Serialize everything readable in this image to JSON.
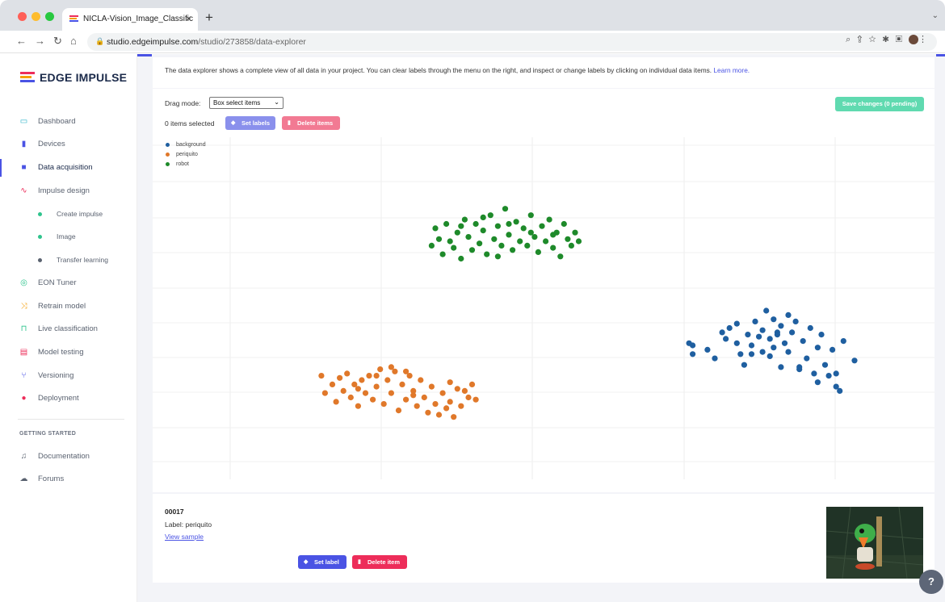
{
  "browser": {
    "tab_title": "NICLA-Vision_Image_Classific",
    "tab_close": "×",
    "new_tab": "+",
    "address_host": "studio.edgeimpulse.com",
    "address_path": "/studio/273858/data-explorer",
    "icons": [
      "back-icon",
      "forward-icon",
      "reload-icon",
      "home-icon",
      "lock-icon",
      "zoom-icon",
      "share-icon",
      "star-icon",
      "extensions-icon",
      "sidebar-icon",
      "profile-icon",
      "menu-icon"
    ]
  },
  "sidebar": {
    "logo_text": "EDGE IMPULSE",
    "items": [
      {
        "label": "Dashboard",
        "icon": "monitor-icon",
        "color": "#2bb3c9"
      },
      {
        "label": "Devices",
        "icon": "device-icon",
        "color": "#4a53e4"
      },
      {
        "label": "Data acquisition",
        "icon": "database-icon",
        "color": "#4a53e4"
      },
      {
        "label": "Impulse design",
        "icon": "pulse-icon",
        "color": "#ed2d5a"
      },
      {
        "label": "Create impulse",
        "color": "#2fc48d"
      },
      {
        "label": "Image",
        "color": "#2fc48d"
      },
      {
        "label": "Transfer learning",
        "color": "#5a6270"
      },
      {
        "label": "EON Tuner",
        "icon": "tuner-icon",
        "color": "#2fc48d"
      },
      {
        "label": "Retrain model",
        "icon": "shuffle-icon",
        "color": "#f59e0b"
      },
      {
        "label": "Live classification",
        "icon": "live-icon",
        "color": "#2fc48d"
      },
      {
        "label": "Model testing",
        "icon": "clipboard-icon",
        "color": "#ed2d5a"
      },
      {
        "label": "Versioning",
        "icon": "branch-icon",
        "color": "#4a53e4"
      },
      {
        "label": "Deployment",
        "icon": "rocket-icon",
        "color": "#ed2d5a"
      }
    ],
    "section_heading": "GETTING STARTED",
    "footer_items": [
      {
        "label": "Documentation",
        "icon": "book-icon"
      },
      {
        "label": "Forums",
        "icon": "chat-icon"
      }
    ]
  },
  "info": {
    "text": "The data explorer shows a complete view of all data in your project. You can clear labels through the menu on the right, and inspect or change labels by clicking on individual data items.",
    "link": "Learn more."
  },
  "controls": {
    "drag_mode_label": "Drag mode:",
    "drag_mode_value": "Box select items",
    "save_changes": "Save changes (0 pending)",
    "items_selected": "0 items selected",
    "set_labels": "Set labels",
    "delete_items": "Delete items"
  },
  "chart_data": {
    "type": "scatter",
    "grid": true,
    "legend_placement": "top-left",
    "series": [
      {
        "name": "background",
        "color": "#1f5fa0",
        "points": [
          [
            0.65,
            -0.35
          ],
          [
            0.66,
            -0.36
          ],
          [
            0.66,
            -0.4
          ],
          [
            0.7,
            -0.38
          ],
          [
            0.72,
            -0.42
          ],
          [
            0.74,
            -0.3
          ],
          [
            0.75,
            -0.33
          ],
          [
            0.76,
            -0.28
          ],
          [
            0.78,
            -0.35
          ],
          [
            0.79,
            -0.4
          ],
          [
            0.8,
            -0.45
          ],
          [
            0.81,
            -0.31
          ],
          [
            0.82,
            -0.36
          ],
          [
            0.83,
            -0.25
          ],
          [
            0.84,
            -0.32
          ],
          [
            0.85,
            -0.39
          ],
          [
            0.85,
            -0.29
          ],
          [
            0.86,
            -0.2
          ],
          [
            0.87,
            -0.33
          ],
          [
            0.87,
            -0.41
          ],
          [
            0.88,
            -0.24
          ],
          [
            0.88,
            -0.37
          ],
          [
            0.89,
            -0.3
          ],
          [
            0.9,
            -0.27
          ],
          [
            0.9,
            -0.46
          ],
          [
            0.91,
            -0.35
          ],
          [
            0.92,
            -0.22
          ],
          [
            0.92,
            -0.39
          ],
          [
            0.93,
            -0.3
          ],
          [
            0.94,
            -0.25
          ],
          [
            0.95,
            -0.46
          ],
          [
            0.96,
            -0.34
          ],
          [
            0.97,
            -0.42
          ],
          [
            0.98,
            -0.28
          ],
          [
            0.99,
            -0.49
          ],
          [
            1.0,
            -0.37
          ],
          [
            1.0,
            -0.53
          ],
          [
            1.01,
            -0.31
          ],
          [
            1.02,
            -0.45
          ],
          [
            1.03,
            -0.5
          ],
          [
            1.04,
            -0.38
          ],
          [
            1.05,
            -0.55
          ],
          [
            1.06,
            -0.57
          ],
          [
            1.07,
            -0.34
          ],
          [
            1.1,
            -0.43
          ],
          [
            0.95,
            -0.47
          ],
          [
            0.89,
            -0.31
          ],
          [
            0.82,
            -0.4
          ],
          [
            0.78,
            -0.26
          ],
          [
            1.05,
            -0.49
          ]
        ]
      },
      {
        "name": "periquito",
        "color": "#e0782a",
        "points": [
          [
            -0.35,
            -0.5
          ],
          [
            -0.34,
            -0.58
          ],
          [
            -0.32,
            -0.54
          ],
          [
            -0.31,
            -0.62
          ],
          [
            -0.3,
            -0.51
          ],
          [
            -0.29,
            -0.57
          ],
          [
            -0.28,
            -0.49
          ],
          [
            -0.27,
            -0.6
          ],
          [
            -0.26,
            -0.54
          ],
          [
            -0.25,
            -0.64
          ],
          [
            -0.24,
            -0.52
          ],
          [
            -0.23,
            -0.58
          ],
          [
            -0.22,
            -0.5
          ],
          [
            -0.21,
            -0.61
          ],
          [
            -0.2,
            -0.55
          ],
          [
            -0.19,
            -0.47
          ],
          [
            -0.18,
            -0.63
          ],
          [
            -0.17,
            -0.52
          ],
          [
            -0.16,
            -0.58
          ],
          [
            -0.15,
            -0.48
          ],
          [
            -0.14,
            -0.66
          ],
          [
            -0.13,
            -0.54
          ],
          [
            -0.12,
            -0.61
          ],
          [
            -0.11,
            -0.5
          ],
          [
            -0.1,
            -0.57
          ],
          [
            -0.09,
            -0.64
          ],
          [
            -0.08,
            -0.52
          ],
          [
            -0.07,
            -0.6
          ],
          [
            -0.06,
            -0.67
          ],
          [
            -0.05,
            -0.55
          ],
          [
            -0.04,
            -0.63
          ],
          [
            -0.03,
            -0.68
          ],
          [
            -0.02,
            -0.58
          ],
          [
            -0.01,
            -0.65
          ],
          [
            0.0,
            -0.62
          ],
          [
            0.01,
            -0.69
          ],
          [
            0.02,
            -0.56
          ],
          [
            0.03,
            -0.64
          ],
          [
            0.05,
            -0.6
          ],
          [
            0.06,
            -0.54
          ],
          [
            0.07,
            -0.61
          ],
          [
            -0.16,
            -0.46
          ],
          [
            -0.2,
            -0.5
          ],
          [
            -0.12,
            -0.48
          ],
          [
            0.0,
            -0.53
          ],
          [
            0.04,
            -0.57
          ],
          [
            -0.25,
            -0.56
          ],
          [
            -0.1,
            -0.59
          ]
        ]
      },
      {
        "name": "robot",
        "color": "#1e8a2a",
        "points": [
          [
            -0.05,
            0.1
          ],
          [
            -0.04,
            0.18
          ],
          [
            -0.03,
            0.13
          ],
          [
            -0.02,
            0.06
          ],
          [
            -0.01,
            0.2
          ],
          [
            0.0,
            0.12
          ],
          [
            0.01,
            0.09
          ],
          [
            0.02,
            0.16
          ],
          [
            0.03,
            0.04
          ],
          [
            0.04,
            0.22
          ],
          [
            0.05,
            0.14
          ],
          [
            0.06,
            0.08
          ],
          [
            0.07,
            0.2
          ],
          [
            0.08,
            0.11
          ],
          [
            0.09,
            0.17
          ],
          [
            0.1,
            0.06
          ],
          [
            0.11,
            0.24
          ],
          [
            0.12,
            0.13
          ],
          [
            0.13,
            0.19
          ],
          [
            0.14,
            0.1
          ],
          [
            0.15,
            0.27
          ],
          [
            0.16,
            0.15
          ],
          [
            0.17,
            0.08
          ],
          [
            0.18,
            0.21
          ],
          [
            0.19,
            0.12
          ],
          [
            0.2,
            0.18
          ],
          [
            0.21,
            0.1
          ],
          [
            0.22,
            0.24
          ],
          [
            0.23,
            0.14
          ],
          [
            0.24,
            0.07
          ],
          [
            0.25,
            0.19
          ],
          [
            0.26,
            0.12
          ],
          [
            0.27,
            0.22
          ],
          [
            0.28,
            0.09
          ],
          [
            0.29,
            0.16
          ],
          [
            0.3,
            0.05
          ],
          [
            0.31,
            0.2
          ],
          [
            0.32,
            0.13
          ],
          [
            0.33,
            0.1
          ],
          [
            0.34,
            0.16
          ],
          [
            0.35,
            0.12
          ],
          [
            0.03,
            0.19
          ],
          [
            0.09,
            0.23
          ],
          [
            0.16,
            0.2
          ],
          [
            0.22,
            0.16
          ],
          [
            0.28,
            0.15
          ],
          [
            0.13,
            0.05
          ]
        ]
      }
    ],
    "x_range": [
      -0.8,
      1.3
    ],
    "y_range": [
      -1.0,
      0.6
    ]
  },
  "selected_item": {
    "id": "00017",
    "label": "Label: periquito",
    "view_sample": "View sample",
    "set_label": "Set label",
    "delete_item": "Delete item"
  },
  "help": {
    "icon": "help-icon",
    "glyph": "?"
  }
}
